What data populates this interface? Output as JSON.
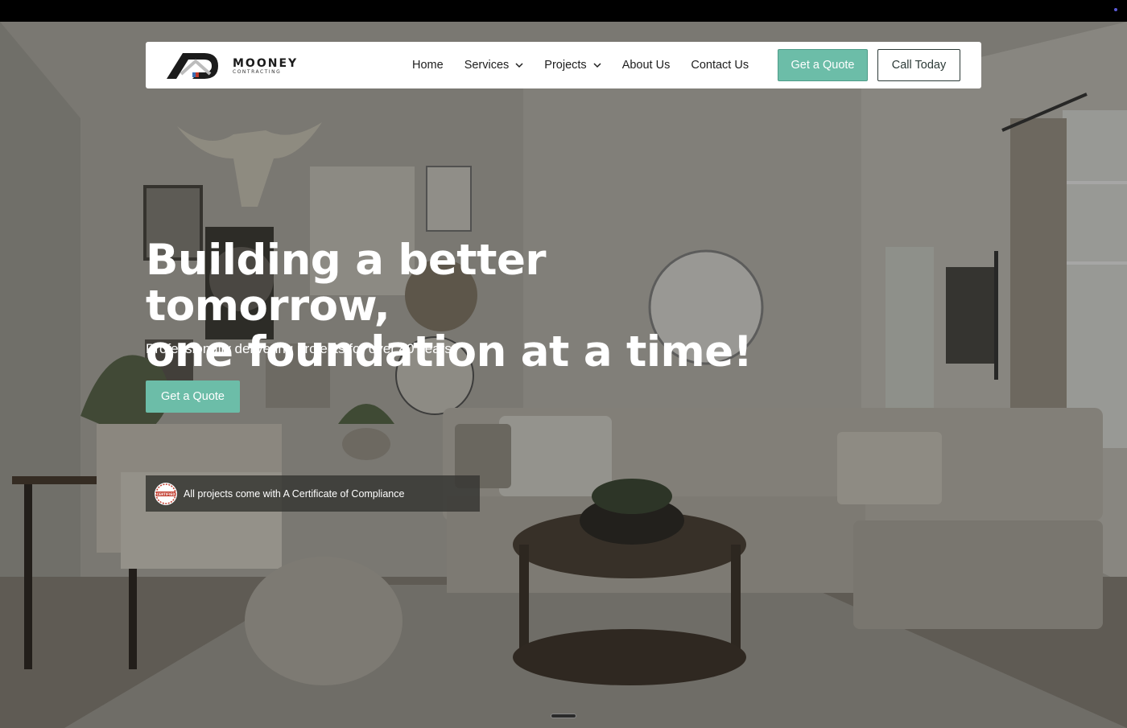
{
  "brand": {
    "name": "MOONEY",
    "sub": "CONTRACTING"
  },
  "nav": {
    "items": [
      {
        "label": "Home",
        "dropdown": false
      },
      {
        "label": "Services",
        "dropdown": true
      },
      {
        "label": "Projects",
        "dropdown": true
      },
      {
        "label": "About Us",
        "dropdown": false
      },
      {
        "label": "Contact Us",
        "dropdown": false
      }
    ],
    "quote_label": "Get a Quote",
    "call_label": "Call Today"
  },
  "hero": {
    "headline_line1": "Building a better tomorrow,",
    "headline_line2": "one foundation at a time!",
    "subline": "Professionally delivering projects for over 40 years.",
    "cta_label": "Get a Quote",
    "certificate_text": "All projects come with A Certificate of Compliance",
    "badge_text": "CERTIFIED"
  },
  "colors": {
    "accent": "#6cbda8",
    "dark": "#2c3a37"
  }
}
